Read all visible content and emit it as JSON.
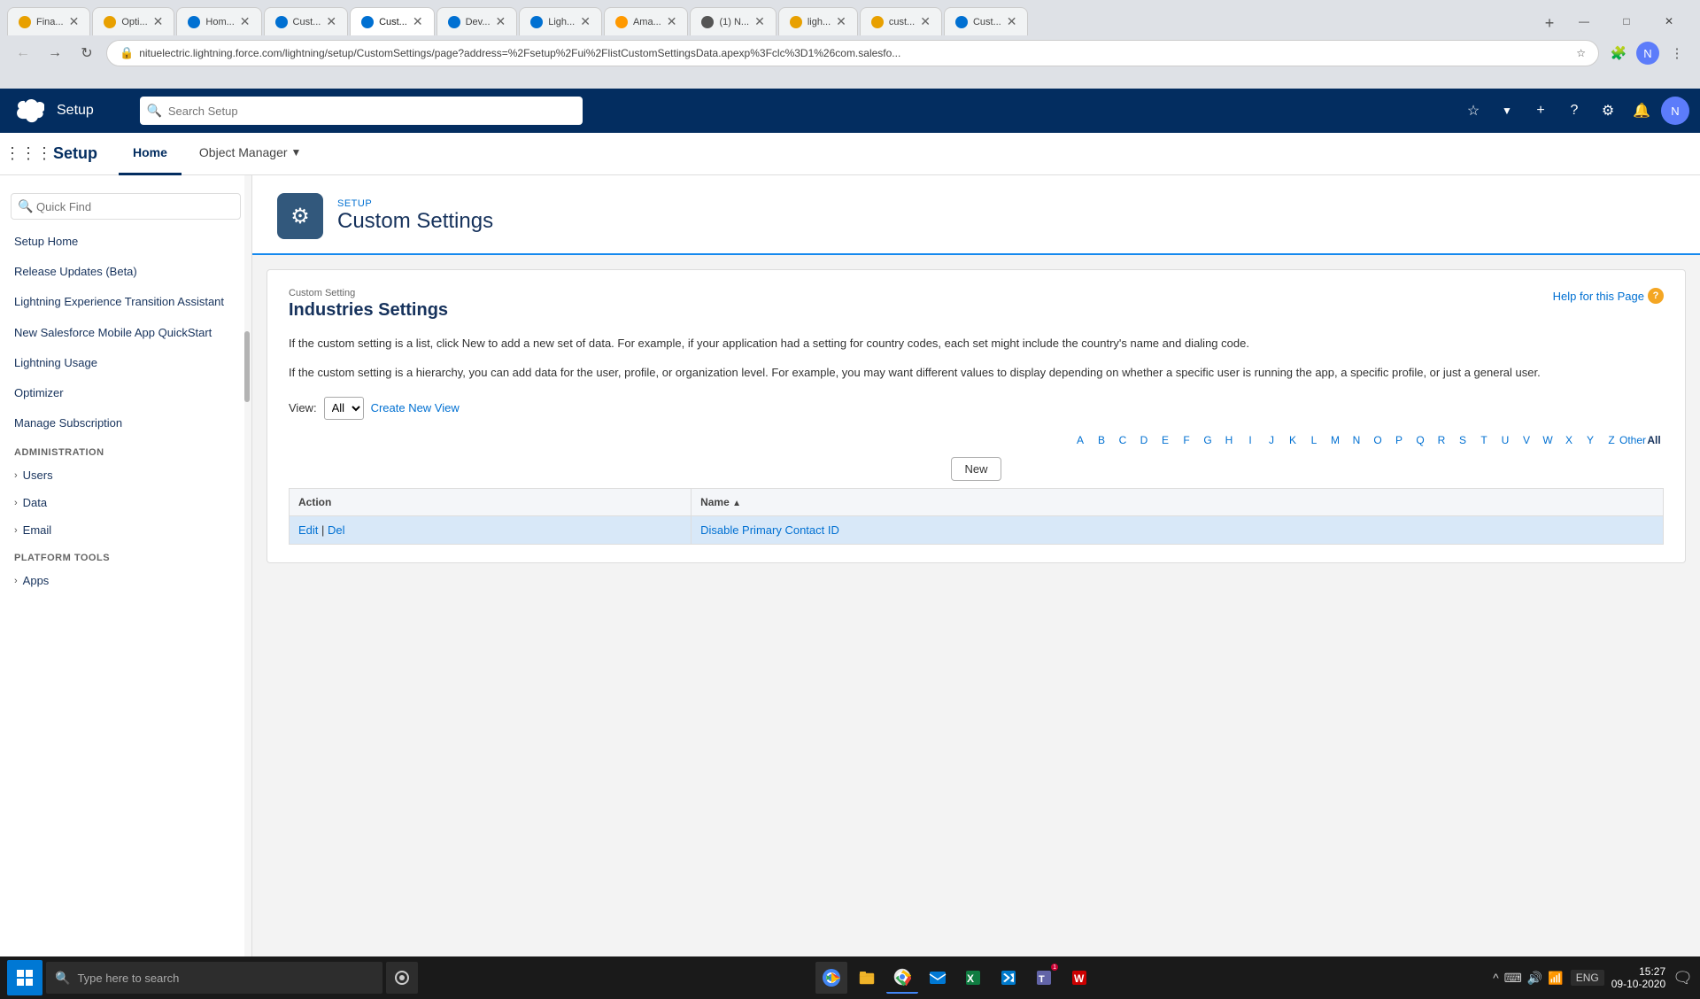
{
  "browser": {
    "tabs": [
      {
        "label": "Fina...",
        "favicon_color": "#e8a000",
        "active": false
      },
      {
        "label": "Opti...",
        "favicon_color": "#e8a000",
        "active": false
      },
      {
        "label": "Hom...",
        "favicon_color": "#0070d2",
        "active": false
      },
      {
        "label": "Cust...",
        "favicon_color": "#0070d2",
        "active": false
      },
      {
        "label": "Cust...",
        "favicon_color": "#0070d2",
        "active": true
      },
      {
        "label": "Dev...",
        "favicon_color": "#0070d2",
        "active": false
      },
      {
        "label": "Ligh...",
        "favicon_color": "#0070d2",
        "active": false
      },
      {
        "label": "Ama...",
        "favicon_color": "#f90",
        "active": false
      },
      {
        "label": "(1) N...",
        "favicon_color": "#555",
        "active": false
      },
      {
        "label": "ligh...",
        "favicon_color": "#e8a000",
        "active": false
      },
      {
        "label": "cust...",
        "favicon_color": "#e8a000",
        "active": false
      },
      {
        "label": "Cust...",
        "favicon_color": "#0070d2",
        "active": false
      }
    ],
    "address": "nituelectric.lightning.force.com/lightning/setup/CustomSettings/page?address=%2Fsetup%2Fui%2FlistCustomSettingsData.apexp%3Fclc%3D1%26com.salesfo...",
    "window_controls": [
      "—",
      "□",
      "✕"
    ]
  },
  "topnav": {
    "search_placeholder": "Search Setup",
    "app_name": "Setup",
    "icons": [
      "☆",
      "+",
      "?",
      "⚙",
      "🔔"
    ]
  },
  "secondnav": {
    "page_title": "Setup",
    "tabs": [
      {
        "label": "Home",
        "active": true
      },
      {
        "label": "Object Manager",
        "active": false,
        "has_dropdown": true
      }
    ]
  },
  "sidebar": {
    "quick_find_placeholder": "Quick Find",
    "items": [
      {
        "label": "Setup Home",
        "type": "link"
      },
      {
        "label": "Release Updates (Beta)",
        "type": "link"
      },
      {
        "label": "Lightning Experience Transition Assistant",
        "type": "link"
      },
      {
        "label": "New Salesforce Mobile App QuickStart",
        "type": "link"
      },
      {
        "label": "Lightning Usage",
        "type": "link"
      },
      {
        "label": "Optimizer",
        "type": "link"
      },
      {
        "label": "Manage Subscription",
        "type": "link"
      }
    ],
    "sections": [
      {
        "label": "ADMINISTRATION",
        "items": [
          {
            "label": "Users",
            "expandable": true
          },
          {
            "label": "Data",
            "expandable": true
          },
          {
            "label": "Email",
            "expandable": true
          }
        ]
      },
      {
        "label": "PLATFORM TOOLS",
        "items": [
          {
            "label": "Apps",
            "expandable": true
          }
        ]
      }
    ]
  },
  "main": {
    "breadcrumb": "SETUP",
    "page_title": "Custom Settings",
    "custom_setting": {
      "label": "Custom Setting",
      "title": "Industries Settings",
      "description1": "If the custom setting is a list, click New to add a new set of data. For example, if your application had a setting for country codes, each set might include the country's name and dialing code.",
      "description2": "If the custom setting is a hierarchy, you can add data for the user, profile, or organization level. For example, you may want different values to display depending on whether a specific user is running the app, a specific profile, or just a general user.",
      "help_link": "Help for this Page"
    },
    "view": {
      "label": "View:",
      "options": [
        "All"
      ],
      "selected": "All",
      "create_new_view": "Create New View"
    },
    "alpha_bar": [
      "A",
      "B",
      "C",
      "D",
      "E",
      "F",
      "G",
      "H",
      "I",
      "J",
      "K",
      "L",
      "M",
      "N",
      "O",
      "P",
      "Q",
      "R",
      "S",
      "T",
      "U",
      "V",
      "W",
      "X",
      "Y",
      "Z",
      "Other",
      "All"
    ],
    "new_button": "New",
    "table": {
      "headers": [
        {
          "label": "Action"
        },
        {
          "label": "Name",
          "sortable": true,
          "sort_dir": "asc"
        }
      ],
      "rows": [
        {
          "actions": [
            "Edit",
            "Del"
          ],
          "name": "Disable Primary Contact ID"
        }
      ]
    }
  },
  "taskbar": {
    "search_placeholder": "Type here to search",
    "apps": [
      "🌐",
      "📁",
      "🟡",
      "📧",
      "🟦",
      "🔵",
      "🔴"
    ],
    "time": "15:27",
    "date": "09-10-2020",
    "system_icons": [
      "^",
      "⌨",
      "🔊",
      "wifi"
    ],
    "notification_label": "ENG"
  }
}
